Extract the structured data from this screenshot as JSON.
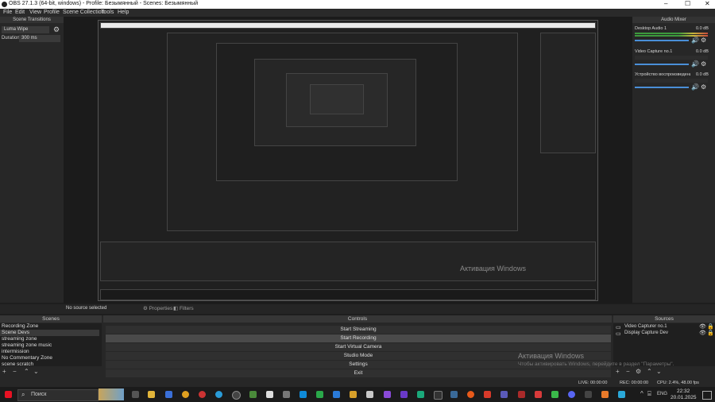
{
  "window": {
    "title": "OBS 27.1.3 (64-bit, windows) - Profile: Безымянный - Scenes: Безымянный",
    "controls": [
      "–",
      "☐",
      "✕"
    ]
  },
  "menu": [
    "File",
    "Edit",
    "View",
    "Profile",
    "Scene Collection",
    "Tools",
    "Help"
  ],
  "scene_transitions": {
    "title": "Scene Transitions",
    "transition": "Luma Wipe",
    "duration_label": "Duration",
    "duration_value": "300 ms"
  },
  "audio_mixer": {
    "title": "Audio Mixer",
    "channels": [
      {
        "name": "Desktop Audio 1",
        "db": "0.0 dB"
      },
      {
        "name": "Video Capture no.1",
        "db": "0.0 dB"
      },
      {
        "name": "Устройство воспроизведения",
        "db": "0.0 dB"
      }
    ]
  },
  "status": {
    "no_source": "No source selected",
    "properties": "Properties",
    "filters": "Filters"
  },
  "scenes": {
    "title": "Scenes",
    "items": [
      "Recording Zone",
      "Scene Devs",
      "streaming zone",
      "streaming zone music",
      "intermission",
      "No Commentary Zone",
      "scene scratch"
    ]
  },
  "controls": {
    "title": "Controls",
    "buttons": [
      "Start Streaming",
      "Start Recording",
      "Start Virtual Camera",
      "Studio Mode",
      "Settings",
      "Exit"
    ]
  },
  "sources": {
    "title": "Sources",
    "items": [
      "Video Capturer no.1",
      "Display Capture Dev"
    ]
  },
  "activation": {
    "line1": "Активация Windows",
    "line2": "Чтобы активировать Windows, перейдите в раздел \"Параметры\"."
  },
  "statusbar": {
    "live": "LIVE: 00:00:00",
    "rec": "REC: 00:00:00",
    "cpu": "CPU: 2.4%, 48.00 fps"
  },
  "taskbar": {
    "search_placeholder": "Поиск",
    "lang": "ENG",
    "time": "22:32",
    "date": "20.01.2025",
    "start_color": "#e81123"
  }
}
